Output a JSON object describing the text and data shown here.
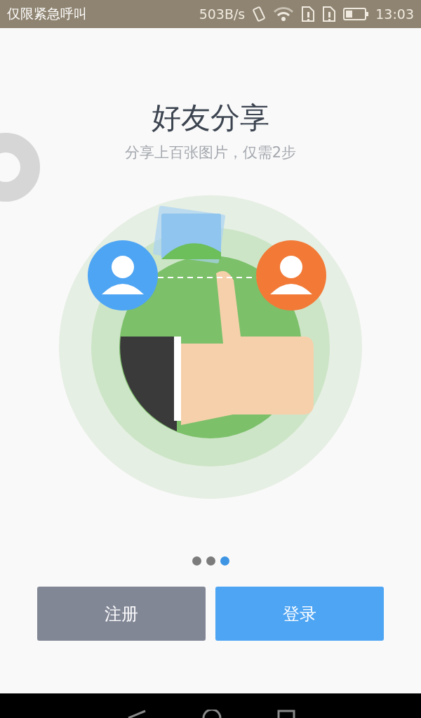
{
  "status_bar": {
    "carrier": "仅限紧急呼叫",
    "speed": "503B/s",
    "time": "13:03"
  },
  "title": "好友分享",
  "subtitle": "分享上百张图片，仅需2步",
  "pages": [
    {
      "selected": false
    },
    {
      "selected": false
    },
    {
      "selected": true
    }
  ],
  "buttons": [
    {
      "kind": "secondary",
      "label": "注册"
    },
    {
      "kind": "primary",
      "label": "登录"
    }
  ]
}
